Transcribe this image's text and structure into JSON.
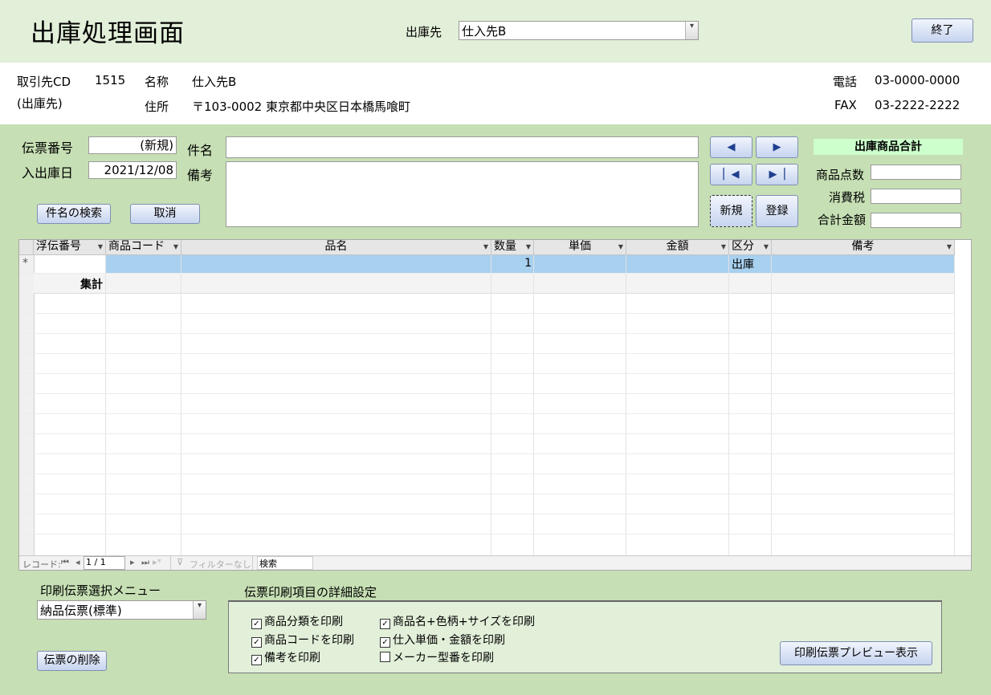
{
  "header": {
    "title": "出庫処理画面",
    "destination_label": "出庫先",
    "destination_value": "仕入先B",
    "exit_button": "終了"
  },
  "partner": {
    "cd_label": "取引先CD",
    "cd_value": "1515",
    "cd_sub": "(出庫先)",
    "name_label": "名称",
    "name_value": "仕入先B",
    "address_label": "住所",
    "address_value": "〒103-0002 東京都中央区日本橋馬喰町",
    "phone_label": "電話",
    "phone_value": "03-0000-0000",
    "fax_label": "FAX",
    "fax_value": "03-2222-2222"
  },
  "form": {
    "slip_no_label": "伝票番号",
    "slip_no_value": "(新規)",
    "date_label": "入出庫日",
    "date_value": "2021/12/08",
    "subject_label": "件名",
    "subject_value": "",
    "note_label": "備考",
    "note_value": "",
    "search_button": "件名の検索",
    "cancel_button": "取消",
    "new_button": "新規",
    "register_button": "登録"
  },
  "totals": {
    "title": "出庫商品合計",
    "items_label": "商品点数",
    "tax_label": "消費税",
    "total_label": "合計金額"
  },
  "table": {
    "columns": [
      "浮伝番号",
      "商品コード",
      "品名",
      "数量",
      "単価",
      "金額",
      "区分",
      "備考"
    ],
    "new_row": {
      "marker": "*",
      "qty": "1",
      "category": "出庫"
    },
    "summary_label": "集計"
  },
  "statusbar": {
    "record_label": "レコード:",
    "position": "1 / 1",
    "filter": "フィルターなし",
    "search": "検索"
  },
  "print": {
    "menu_label": "印刷伝票選択メニュー",
    "menu_value": "納品伝票(標準)",
    "delete_button": "伝票の削除",
    "detail_label": "伝票印刷項目の詳細設定",
    "options": [
      {
        "label": "商品分類を印刷",
        "checked": true
      },
      {
        "label": "商品名+色柄+サイズを印刷",
        "checked": true
      },
      {
        "label": "商品コードを印刷",
        "checked": true
      },
      {
        "label": "仕入単価・金額を印刷",
        "checked": true
      },
      {
        "label": "備考を印刷",
        "checked": true
      },
      {
        "label": "メーカー型番を印刷",
        "checked": false
      }
    ],
    "preview_button": "印刷伝票プレビュー表示"
  }
}
